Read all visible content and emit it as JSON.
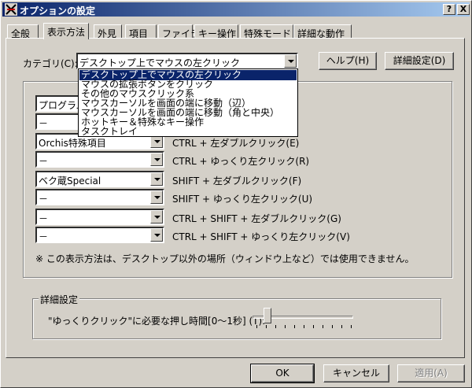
{
  "window": {
    "title": "オプションの設定",
    "help_button": "?",
    "close_button": "X"
  },
  "tabs": [
    {
      "label": "全般"
    },
    {
      "label": "表示方法"
    },
    {
      "label": "外見"
    },
    {
      "label": "項目"
    },
    {
      "label": "ファイラ"
    },
    {
      "label": "キー操作"
    },
    {
      "label": "特殊モード"
    },
    {
      "label": "詳細な動作"
    }
  ],
  "category": {
    "label": "カテゴリ(C):",
    "value": "デスクトップ上でマウスの左クリック",
    "options": [
      "デスクトップ上でマウスの左クリック",
      "マウスの拡張ボタンをクリック",
      "その他のマウスクリック系",
      "マウスカーソルを画面の端に移動（辺）",
      "マウスカーソルを画面の端に移動（角と中央）",
      "ホットキー＆特殊なキー操作",
      "タスクトレイ"
    ]
  },
  "buttons": {
    "help": "ヘルプ(H)",
    "details": "詳細設定(D)",
    "ok": "OK",
    "cancel": "キャンセル",
    "apply": "適用(A)"
  },
  "assignments": [
    {
      "value": "プログラム",
      "action": ""
    },
    {
      "value": "－",
      "action": ""
    },
    {
      "value": "Orchis特殊項目",
      "action": "CTRL + 左ダブルクリック(E)"
    },
    {
      "value": "－",
      "action": "CTRL + ゆっくり左クリック(R)"
    },
    {
      "value": "ベク蔵Special",
      "action": "SHIFT + 左ダブルクリック(F)"
    },
    {
      "value": "－",
      "action": "SHIFT + ゆっくり左クリック(U)"
    },
    {
      "value": "－",
      "action": "CTRL + SHIFT + 左ダブルクリック(G)"
    },
    {
      "value": "－",
      "action": "CTRL + SHIFT + ゆっくり左クリック(V)"
    }
  ],
  "note": "※ この表示方法は、デスクトップ以外の場所（ウィンドウ上など）では使用できません。",
  "details_group": {
    "title": "詳細設定",
    "slow_click_label": "\"ゆっくりクリック\"に必要な押し時間[0〜1秒] (T):",
    "slider_value": 0.15
  }
}
